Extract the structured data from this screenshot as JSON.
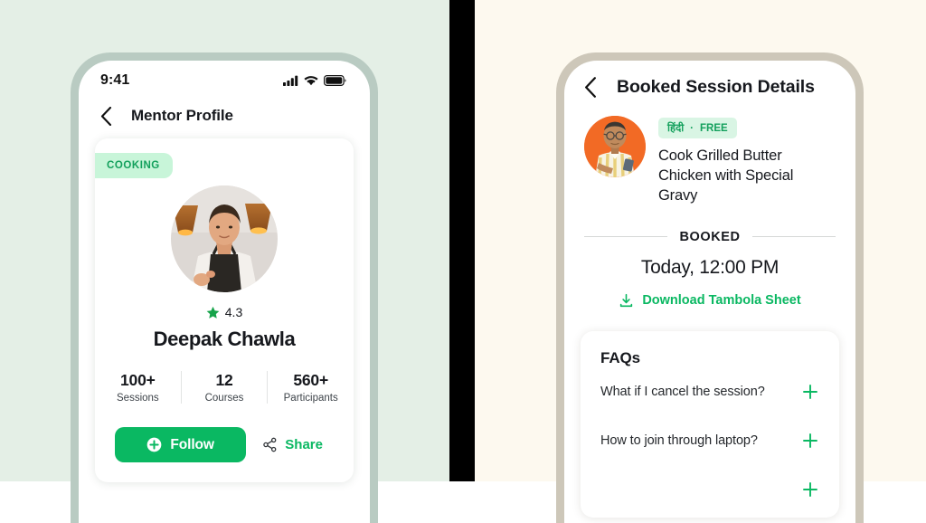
{
  "theme": {
    "left_background": "#e4efe6",
    "right_background": "#fdf9ef",
    "divider_color": "#000000",
    "left_frame": "#b9cbc2",
    "right_frame": "#cdc7b9",
    "accent_green": "#0ab862",
    "badge_green_bg": "#c8f5d9",
    "badge_green_text": "#13a05c",
    "avatar_orange": "#f26a25"
  },
  "left_screen": {
    "status_bar": {
      "time": "9:41",
      "icons": [
        "cellular-signal-icon",
        "wifi-icon",
        "battery-icon"
      ]
    },
    "nav": {
      "back_icon": "chevron-left-icon",
      "title": "Mentor Profile"
    },
    "card": {
      "category_badge": "COOKING",
      "avatar_alt": "mentor-photo",
      "rating": {
        "icon": "star-icon",
        "value": "4.3"
      },
      "name": "Deepak Chawla",
      "stats": [
        {
          "value": "100+",
          "label": "Sessions"
        },
        {
          "value": "12",
          "label": "Courses"
        },
        {
          "value": "560+",
          "label": "Participants"
        }
      ],
      "follow_button": {
        "label": "Follow",
        "icon": "plus-circle-icon"
      },
      "share_button": {
        "label": "Share",
        "icon": "share-icon"
      }
    }
  },
  "right_screen": {
    "nav": {
      "back_icon": "chevron-left-icon",
      "title": "Booked Session Details"
    },
    "session": {
      "avatar_alt": "session-host-photo",
      "language_tag": "हिंदी",
      "tag_separator": "·",
      "price_tag": "FREE",
      "title": "Cook Grilled Butter Chicken with Special Gravy",
      "status_label": "BOOKED",
      "time": "Today, 12:00 PM",
      "download_link": {
        "label": "Download Tambola Sheet",
        "icon": "download-icon"
      }
    },
    "faqs": {
      "title": "FAQs",
      "items": [
        {
          "question": "What if I cancel the session?",
          "icon": "plus-icon"
        },
        {
          "question": "How to join through laptop?",
          "icon": "plus-icon"
        },
        {
          "question": "",
          "icon": "plus-icon"
        }
      ]
    }
  }
}
